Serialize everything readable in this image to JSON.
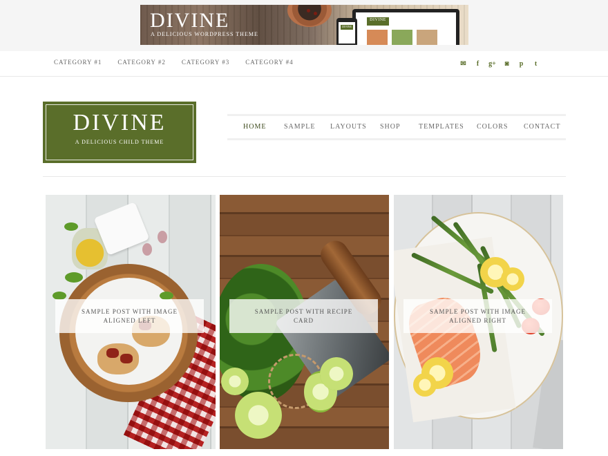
{
  "banner": {
    "title": "DIVINE",
    "subtitle": "A DELICIOUS WORDPRESS THEME",
    "device_logo": "DIVINE"
  },
  "categories": {
    "items": [
      "CATEGORY #1",
      "CATEGORY #2",
      "CATEGORY #3",
      "CATEGORY #4"
    ]
  },
  "social": {
    "items": [
      {
        "icon": "email-icon",
        "glyph": "✉"
      },
      {
        "icon": "facebook-icon",
        "glyph": "f"
      },
      {
        "icon": "google-plus-icon",
        "glyph": "g+"
      },
      {
        "icon": "instagram-icon",
        "glyph": "◙"
      },
      {
        "icon": "pinterest-icon",
        "glyph": "p"
      },
      {
        "icon": "twitter-icon",
        "glyph": "t"
      }
    ]
  },
  "logo": {
    "title": "DIVINE",
    "subtitle": "A DELICIOUS CHILD THEME"
  },
  "nav": {
    "items": [
      "HOME",
      "SAMPLE",
      "LAYOUTS",
      "SHOP",
      "TEMPLATES",
      "COLORS",
      "CONTACT"
    ],
    "active": "HOME"
  },
  "posts": {
    "items": [
      {
        "title": "SAMPLE POST WITH IMAGE ALIGNED LEFT"
      },
      {
        "title": "SAMPLE POST WITH RECIPE CARD"
      },
      {
        "title": "SAMPLE POST WITH IMAGE ALIGNED RIGHT"
      }
    ]
  },
  "colors": {
    "brand_green": "#5a6e2a",
    "nav_text": "#666666"
  }
}
